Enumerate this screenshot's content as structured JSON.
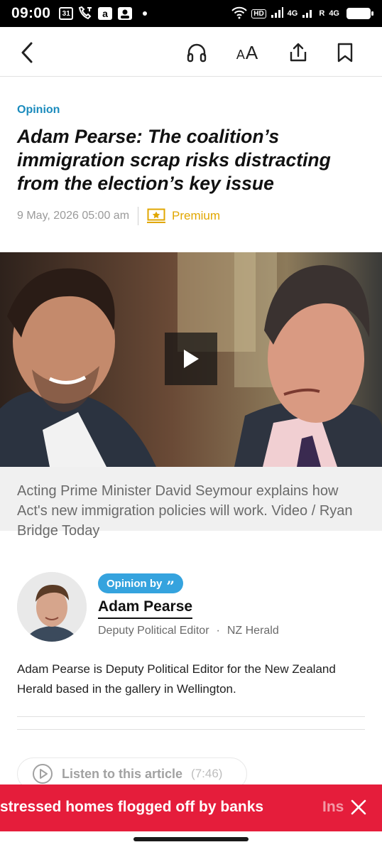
{
  "status_bar": {
    "time": "09:00",
    "calendar_day": "31",
    "hd_label": "HD",
    "network_1": "4G",
    "network_2": "4G",
    "roaming": "R"
  },
  "toolbar": {
    "font_size_label_small": "A",
    "font_size_label_large": "A",
    "icons": [
      "back-arrow-icon",
      "headphones-icon",
      "text-size-icon",
      "share-icon",
      "bookmark-icon"
    ]
  },
  "article": {
    "section": "Opinion",
    "headline": "Adam Pearse: The coalition’s immigration scrap risks distracting from the election’s key issue",
    "date": "9 May, 2026 05:00 am",
    "premium_label": "Premium",
    "caption": "Acting Prime Minister David Seymour explains how Act's new immigration policies will work. Video / Ryan Bridge Today"
  },
  "author": {
    "pill_label": "Opinion by",
    "name": "Adam Pearse",
    "role": "Deputy Political Editor",
    "separator": "·",
    "outlet": "NZ Herald",
    "bio": "Adam Pearse is Deputy Political Editor for the New Zealand Herald based in the gallery in Wellington."
  },
  "listen": {
    "label": "Listen to this article",
    "duration": "(7:46)"
  },
  "ticker": {
    "text": "stressed homes flogged off by banks",
    "next_text": "Ins"
  },
  "colors": {
    "section_blue": "#1a8bbd",
    "premium_gold": "#e1a700",
    "pill_blue": "#35a3de",
    "ticker_red": "#e51d3b"
  }
}
